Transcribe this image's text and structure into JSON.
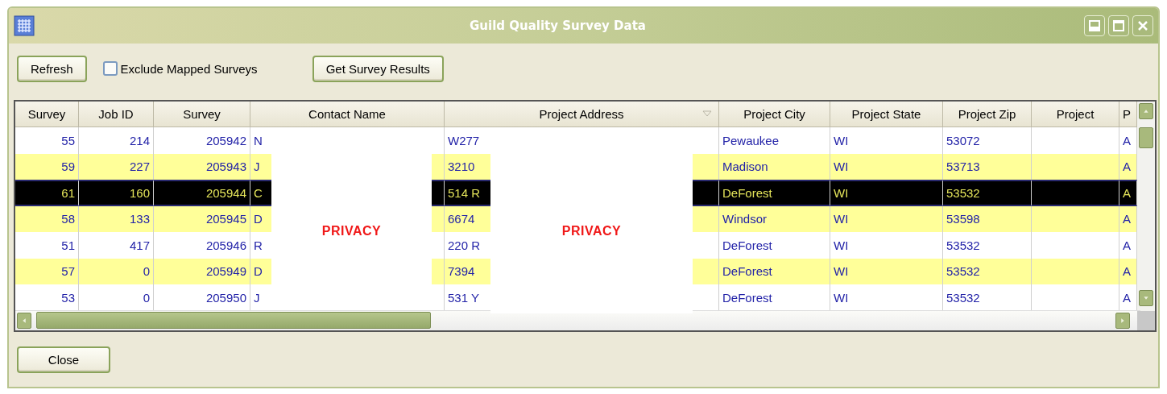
{
  "window": {
    "title": "Guild Quality Survey Data"
  },
  "toolbar": {
    "refresh_button": "Refresh",
    "exclude_checkbox": {
      "label": "Exclude Mapped Surveys",
      "checked": false
    },
    "results_button": "Get Survey Results"
  },
  "table": {
    "columns": [
      {
        "label": "Survey",
        "sorted": false
      },
      {
        "label": "Job ID",
        "sorted": false
      },
      {
        "label": "Survey",
        "sorted": false
      },
      {
        "label": "Contact Name",
        "sorted": false
      },
      {
        "label": "Project Address",
        "sorted": true
      },
      {
        "label": "Project City",
        "sorted": false
      },
      {
        "label": "Project State",
        "sorted": false
      },
      {
        "label": "Project Zip",
        "sorted": false
      },
      {
        "label": "Project",
        "sorted": false
      },
      {
        "label": "P",
        "sorted": false
      }
    ],
    "rows": [
      {
        "selected": false,
        "cells": [
          "55",
          "214",
          "205942",
          "N",
          "W277",
          "Pewaukee",
          "WI",
          "53072",
          null,
          "A"
        ]
      },
      {
        "selected": false,
        "cells": [
          "59",
          "227",
          "205943",
          "J",
          "3210",
          "Madison",
          "WI",
          "53713",
          null,
          "A"
        ]
      },
      {
        "selected": true,
        "cells": [
          "61",
          "160",
          "205944",
          "C",
          "514 R",
          "DeForest",
          "WI",
          "53532",
          null,
          "A"
        ]
      },
      {
        "selected": false,
        "cells": [
          "58",
          "133",
          "205945",
          "D",
          "6674",
          "Windsor",
          "WI",
          "53598",
          null,
          "A"
        ]
      },
      {
        "selected": false,
        "cells": [
          "51",
          "417",
          "205946",
          "R",
          "220 R",
          "DeForest",
          "WI",
          "53532",
          null,
          "A"
        ]
      },
      {
        "selected": false,
        "cells": [
          "57",
          "0",
          "205949",
          "D",
          "7394",
          "DeForest",
          "WI",
          "53532",
          null,
          "A"
        ]
      },
      {
        "selected": false,
        "cells": [
          "53",
          "0",
          "205950",
          "J",
          "531 Y",
          "DeForest",
          "WI",
          "53532",
          null,
          "A"
        ]
      }
    ],
    "privacy_masks": [
      {
        "label": "PRIVACY"
      },
      {
        "label": "PRIVACY"
      }
    ]
  },
  "footer": {
    "close_button": "Close"
  }
}
